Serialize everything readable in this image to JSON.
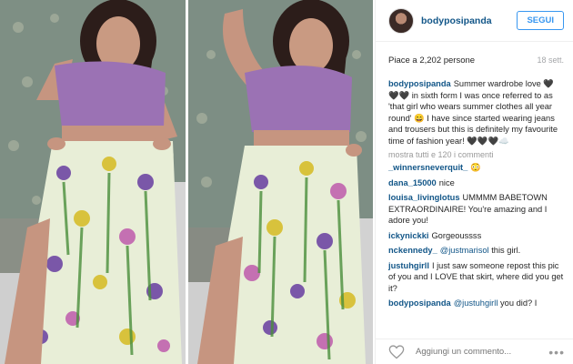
{
  "post": {
    "username": "bodyposipanda",
    "follow_label": "SEGUI",
    "likes_text": "Piace a 2,202 persone",
    "date": "18 sett.",
    "caption_user": "bodyposipanda",
    "caption_text": "Summer wardrobe love 🖤🖤🖤 in sixth form I was once referred to as 'that girl who wears summer clothes all year round' 😄 I have since started wearing jeans and trousers but this is definitely my favourite time of fashion year! 🖤🖤🖤☁️",
    "more_comments": "mostra tutti e 120 i commenti",
    "comments": [
      {
        "user": "_winnersneverquit_",
        "mention": "",
        "text": "😳"
      },
      {
        "user": "dana_15000",
        "mention": "",
        "text": "nice"
      },
      {
        "user": "louisa_livinglotus",
        "mention": "",
        "text": "UMMMM BABETOWN EXTRAORDINAIRE! You're amazing and I adore you!"
      },
      {
        "user": "ickynickki",
        "mention": "",
        "text": "Gorgeoussss"
      },
      {
        "user": "nckennedy_",
        "mention": "@justmarisol",
        "text": "this girl."
      },
      {
        "user": "justuhgirll",
        "mention": "",
        "text": "I just saw someone repost this pic of you and I LOVE that skirt, where did you get it?"
      },
      {
        "user": "bodyposipanda",
        "mention": "@justuhgirll",
        "text": "you did? I"
      }
    ],
    "comment_placeholder": "Aggiungi un commento...",
    "options_icon": "more-options-icon",
    "like_icon": "heart-icon"
  }
}
